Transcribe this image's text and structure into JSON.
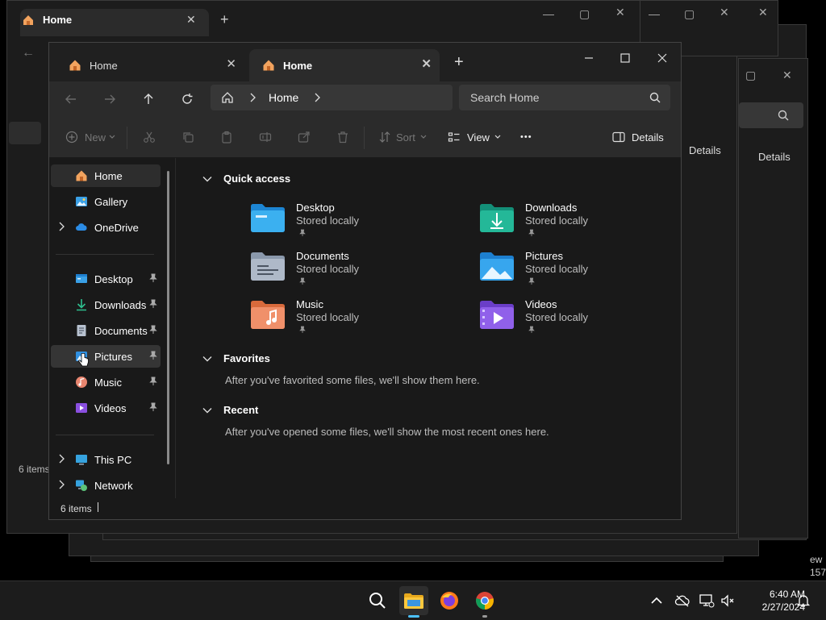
{
  "window": {
    "tabs": [
      {
        "title": "Home",
        "active": false
      },
      {
        "title": "Home",
        "active": true
      }
    ],
    "new_tab": "+",
    "controls": {
      "minimize": "—",
      "maximize": "▢",
      "close": "✕"
    }
  },
  "address_bar": {
    "location": "Home"
  },
  "search": {
    "placeholder": "Search Home"
  },
  "command_bar": {
    "new_label": "New",
    "sort_label": "Sort",
    "view_label": "View",
    "more_label": "•••",
    "details_label": "Details"
  },
  "nav_pane": {
    "items": [
      {
        "label": "Home",
        "icon": "home-icon"
      },
      {
        "label": "Gallery",
        "icon": "gallery-icon"
      },
      {
        "label": "OneDrive",
        "icon": "cloud-icon"
      },
      {
        "label": "Desktop",
        "icon": "desktop-folder-icon"
      },
      {
        "label": "Downloads",
        "icon": "download-icon"
      },
      {
        "label": "Documents",
        "icon": "documents-icon"
      },
      {
        "label": "Pictures",
        "icon": "pictures-icon"
      },
      {
        "label": "Music",
        "icon": "music-icon"
      },
      {
        "label": "Videos",
        "icon": "videos-icon"
      },
      {
        "label": "This PC",
        "icon": "monitor-icon"
      },
      {
        "label": "Network",
        "icon": "network-icon"
      }
    ]
  },
  "sections": {
    "quick_access": "Quick access",
    "favorites": "Favorites",
    "favorites_empty": "After you've favorited some files, we'll show them here.",
    "recent": "Recent",
    "recent_empty": "After you've opened some files, we'll show the most recent ones here."
  },
  "quick_access": [
    {
      "name": "Desktop",
      "status": "Stored locally",
      "icon": "desktop-folder-icon"
    },
    {
      "name": "Downloads",
      "status": "Stored locally",
      "icon": "downloads-folder-icon"
    },
    {
      "name": "Documents",
      "status": "Stored locally",
      "icon": "documents-folder-icon"
    },
    {
      "name": "Pictures",
      "status": "Stored locally",
      "icon": "pictures-folder-icon"
    },
    {
      "name": "Music",
      "status": "Stored locally",
      "icon": "music-folder-icon"
    },
    {
      "name": "Videos",
      "status": "Stored locally",
      "icon": "videos-folder-icon"
    }
  ],
  "status_bar": {
    "items": "6 items"
  },
  "background_windows": {
    "tab_title": "Home",
    "details_label": "Details",
    "items": "6 items",
    "edge_text_top": "ew",
    "edge_text_bottom": "157"
  },
  "taskbar": {
    "apps": [
      "search-icon",
      "file-explorer-icon",
      "firefox-icon",
      "chrome-icon"
    ],
    "time": "6:40 AM",
    "date": "2/27/2024"
  },
  "colors": {
    "accent": "#4cc2ff",
    "folder_blue": "#2d9cdb",
    "folder_green": "#1fb39a"
  }
}
